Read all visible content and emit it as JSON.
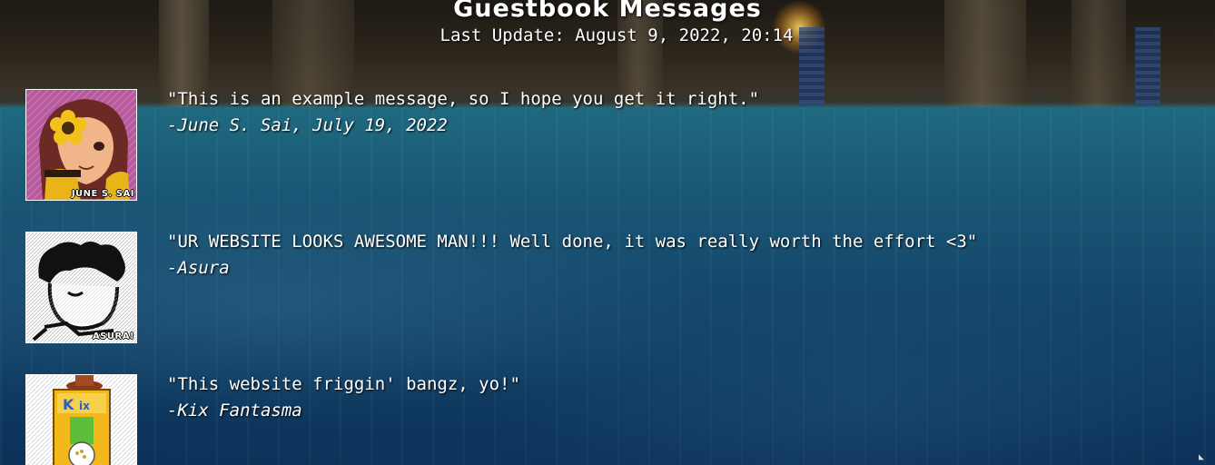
{
  "header": {
    "title": "Guestbook Messages",
    "last_update": "Last Update: August 9, 2022, 20:14"
  },
  "messages": [
    {
      "text": "\"This is an example message, so I hope you get it right.\"",
      "author": "-June S. Sai, July 19, 2022",
      "avatar_tag": "JUNE S. SAI",
      "avatar_icon": "june-avatar-icon"
    },
    {
      "text": "\"UR WEBSITE LOOKS AWESOME MAN!!! Well done, it was really worth the effort <3\"",
      "author": "-Asura",
      "avatar_tag": "ASURA!",
      "avatar_icon": "asura-avatar-icon"
    },
    {
      "text": "\"This website friggin' bangz, yo!\"",
      "author": "-Kix Fantasma",
      "avatar_tag": "",
      "avatar_icon": "kix-avatar-icon"
    }
  ],
  "colors": {
    "text": "#ffffff",
    "water": "#14466a",
    "wall": "#2b251b"
  }
}
